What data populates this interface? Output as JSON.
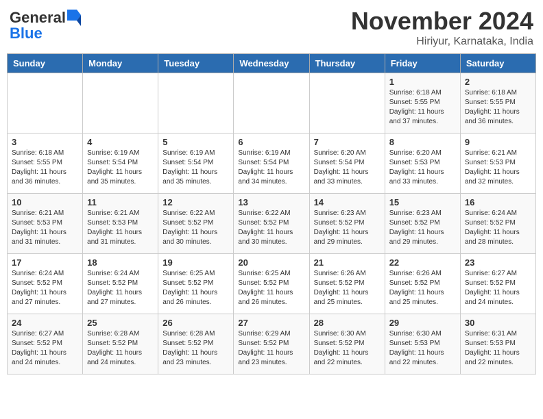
{
  "logo": {
    "line1": "General",
    "line2": "Blue"
  },
  "title": "November 2024",
  "location": "Hiriyur, Karnataka, India",
  "headers": [
    "Sunday",
    "Monday",
    "Tuesday",
    "Wednesday",
    "Thursday",
    "Friday",
    "Saturday"
  ],
  "weeks": [
    [
      {
        "day": "",
        "info": ""
      },
      {
        "day": "",
        "info": ""
      },
      {
        "day": "",
        "info": ""
      },
      {
        "day": "",
        "info": ""
      },
      {
        "day": "",
        "info": ""
      },
      {
        "day": "1",
        "info": "Sunrise: 6:18 AM\nSunset: 5:55 PM\nDaylight: 11 hours\nand 37 minutes."
      },
      {
        "day": "2",
        "info": "Sunrise: 6:18 AM\nSunset: 5:55 PM\nDaylight: 11 hours\nand 36 minutes."
      }
    ],
    [
      {
        "day": "3",
        "info": "Sunrise: 6:18 AM\nSunset: 5:55 PM\nDaylight: 11 hours\nand 36 minutes."
      },
      {
        "day": "4",
        "info": "Sunrise: 6:19 AM\nSunset: 5:54 PM\nDaylight: 11 hours\nand 35 minutes."
      },
      {
        "day": "5",
        "info": "Sunrise: 6:19 AM\nSunset: 5:54 PM\nDaylight: 11 hours\nand 35 minutes."
      },
      {
        "day": "6",
        "info": "Sunrise: 6:19 AM\nSunset: 5:54 PM\nDaylight: 11 hours\nand 34 minutes."
      },
      {
        "day": "7",
        "info": "Sunrise: 6:20 AM\nSunset: 5:54 PM\nDaylight: 11 hours\nand 33 minutes."
      },
      {
        "day": "8",
        "info": "Sunrise: 6:20 AM\nSunset: 5:53 PM\nDaylight: 11 hours\nand 33 minutes."
      },
      {
        "day": "9",
        "info": "Sunrise: 6:21 AM\nSunset: 5:53 PM\nDaylight: 11 hours\nand 32 minutes."
      }
    ],
    [
      {
        "day": "10",
        "info": "Sunrise: 6:21 AM\nSunset: 5:53 PM\nDaylight: 11 hours\nand 31 minutes."
      },
      {
        "day": "11",
        "info": "Sunrise: 6:21 AM\nSunset: 5:53 PM\nDaylight: 11 hours\nand 31 minutes."
      },
      {
        "day": "12",
        "info": "Sunrise: 6:22 AM\nSunset: 5:52 PM\nDaylight: 11 hours\nand 30 minutes."
      },
      {
        "day": "13",
        "info": "Sunrise: 6:22 AM\nSunset: 5:52 PM\nDaylight: 11 hours\nand 30 minutes."
      },
      {
        "day": "14",
        "info": "Sunrise: 6:23 AM\nSunset: 5:52 PM\nDaylight: 11 hours\nand 29 minutes."
      },
      {
        "day": "15",
        "info": "Sunrise: 6:23 AM\nSunset: 5:52 PM\nDaylight: 11 hours\nand 29 minutes."
      },
      {
        "day": "16",
        "info": "Sunrise: 6:24 AM\nSunset: 5:52 PM\nDaylight: 11 hours\nand 28 minutes."
      }
    ],
    [
      {
        "day": "17",
        "info": "Sunrise: 6:24 AM\nSunset: 5:52 PM\nDaylight: 11 hours\nand 27 minutes."
      },
      {
        "day": "18",
        "info": "Sunrise: 6:24 AM\nSunset: 5:52 PM\nDaylight: 11 hours\nand 27 minutes."
      },
      {
        "day": "19",
        "info": "Sunrise: 6:25 AM\nSunset: 5:52 PM\nDaylight: 11 hours\nand 26 minutes."
      },
      {
        "day": "20",
        "info": "Sunrise: 6:25 AM\nSunset: 5:52 PM\nDaylight: 11 hours\nand 26 minutes."
      },
      {
        "day": "21",
        "info": "Sunrise: 6:26 AM\nSunset: 5:52 PM\nDaylight: 11 hours\nand 25 minutes."
      },
      {
        "day": "22",
        "info": "Sunrise: 6:26 AM\nSunset: 5:52 PM\nDaylight: 11 hours\nand 25 minutes."
      },
      {
        "day": "23",
        "info": "Sunrise: 6:27 AM\nSunset: 5:52 PM\nDaylight: 11 hours\nand 24 minutes."
      }
    ],
    [
      {
        "day": "24",
        "info": "Sunrise: 6:27 AM\nSunset: 5:52 PM\nDaylight: 11 hours\nand 24 minutes."
      },
      {
        "day": "25",
        "info": "Sunrise: 6:28 AM\nSunset: 5:52 PM\nDaylight: 11 hours\nand 24 minutes."
      },
      {
        "day": "26",
        "info": "Sunrise: 6:28 AM\nSunset: 5:52 PM\nDaylight: 11 hours\nand 23 minutes."
      },
      {
        "day": "27",
        "info": "Sunrise: 6:29 AM\nSunset: 5:52 PM\nDaylight: 11 hours\nand 23 minutes."
      },
      {
        "day": "28",
        "info": "Sunrise: 6:30 AM\nSunset: 5:52 PM\nDaylight: 11 hours\nand 22 minutes."
      },
      {
        "day": "29",
        "info": "Sunrise: 6:30 AM\nSunset: 5:53 PM\nDaylight: 11 hours\nand 22 minutes."
      },
      {
        "day": "30",
        "info": "Sunrise: 6:31 AM\nSunset: 5:53 PM\nDaylight: 11 hours\nand 22 minutes."
      }
    ]
  ]
}
